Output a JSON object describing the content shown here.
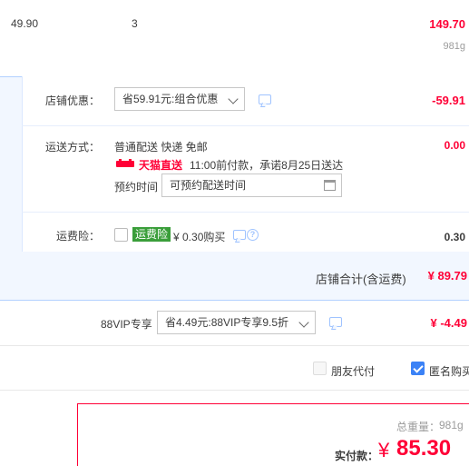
{
  "item": {
    "unit_price": "49.90",
    "quantity": "3",
    "subtotal": "149.70",
    "weight": "981g"
  },
  "shop": {
    "discount_label": "店铺优惠：",
    "discount_select": "省59.91元:组合优惠",
    "discount_amount": "-59.91",
    "shipping_label": "运送方式：",
    "shipping_methods": "普通配送 快递 免邮",
    "shipping_fee": "0.00",
    "tmall_direct": "天猫直送",
    "promise_text": "11:00前付款，承诺8月25日送达",
    "schedule_label": "预约时间",
    "schedule_placeholder": "可预约配送时间",
    "insurance_label": "运费险：",
    "insurance_badge": "运费险",
    "insurance_price": "¥ 0.30购买",
    "insurance_fee": "0.30",
    "total_label": "店铺合计(含运费)",
    "total_value": "¥ 89.79"
  },
  "vip": {
    "label": "88VIP专享",
    "select": "省4.49元:88VIP专享9.5折",
    "amount": "¥ -4.49"
  },
  "options": {
    "friend_pay": "朋友代付",
    "anonymous": "匿名购买"
  },
  "summary": {
    "weight_label": "总重量：",
    "weight_value": "981g",
    "pay_label": "实付款：",
    "currency": "¥",
    "pay_value": "85.30"
  },
  "colors": {
    "accent_red": "#ff0036",
    "box_border": "#b2d1ff",
    "box_bg": "#f2f7ff",
    "summary_border": "#ff0036"
  }
}
